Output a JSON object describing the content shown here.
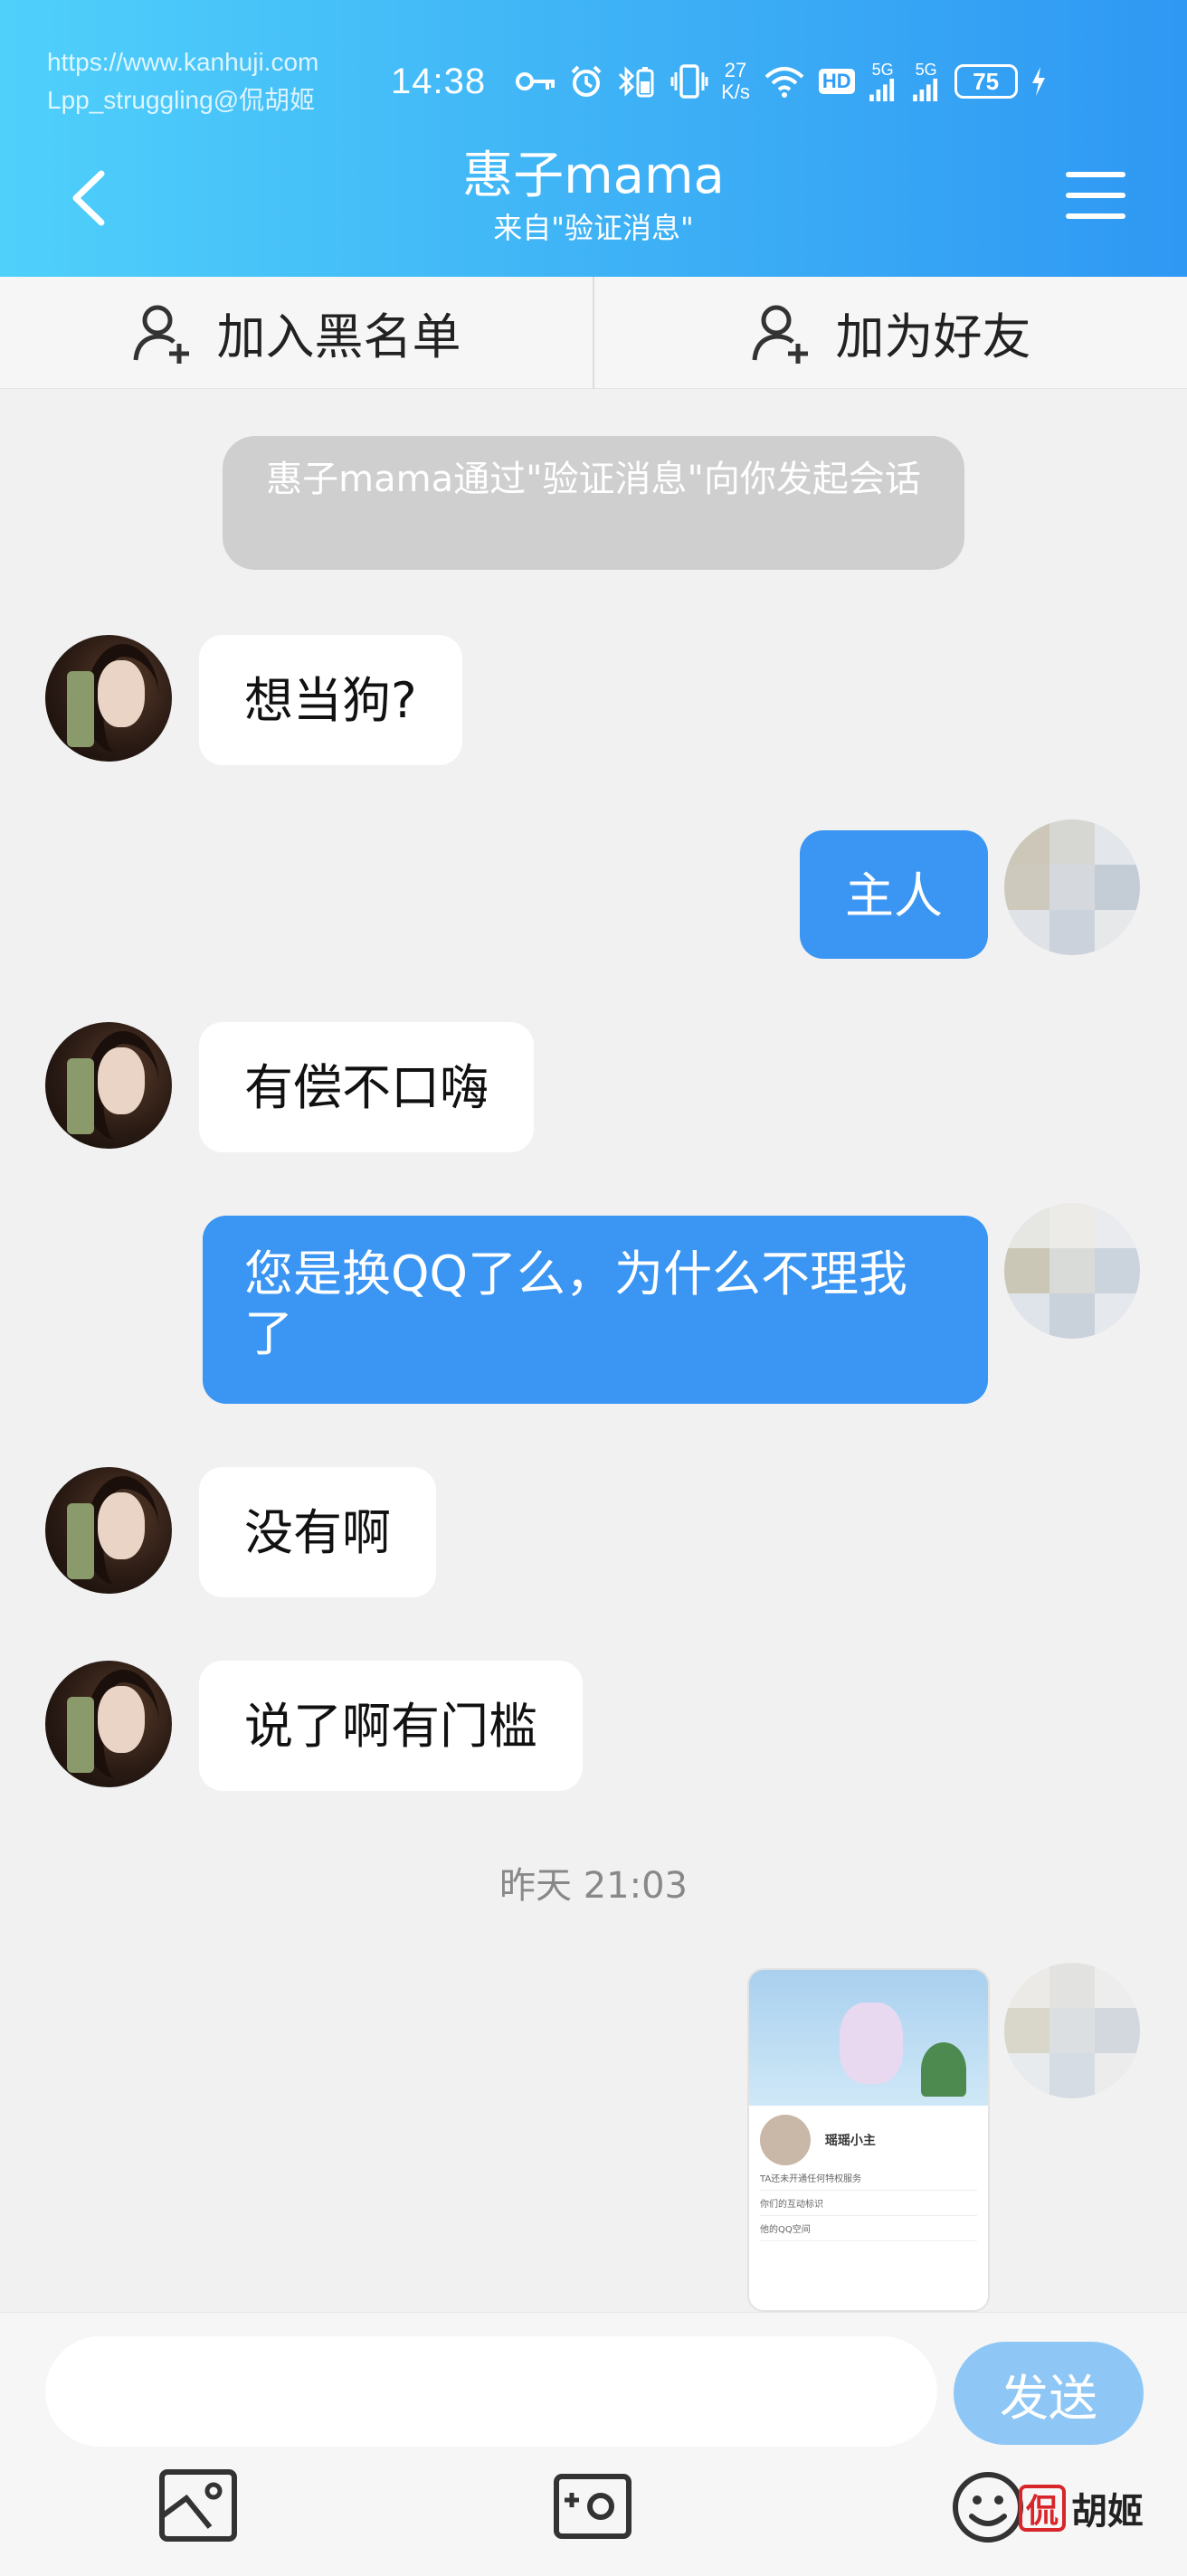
{
  "watermark": {
    "url": "https://www.kanhuji.com",
    "handle": "Lpp_struggling@侃胡姬"
  },
  "status_bar": {
    "time": "14:38",
    "net_speed_value": "27",
    "net_speed_unit": "K/s",
    "hd": "HD",
    "sim1_label": "5G",
    "sim2_label": "5G",
    "battery": "75"
  },
  "header": {
    "title": "惠子mama",
    "subtitle": "来自\"验证消息\""
  },
  "actions": {
    "blacklist_label": "加入黑名单",
    "add_friend_label": "加为好友"
  },
  "system_notice": "惠子mama通过\"验证消息\"向你发起会话",
  "messages": [
    {
      "side": "in",
      "text": "想当狗?"
    },
    {
      "side": "out",
      "text": "主人"
    },
    {
      "side": "in",
      "text": "有偿不口嗨"
    },
    {
      "side": "out",
      "text": "您是换QQ了么，为什么不理我了"
    },
    {
      "side": "in",
      "text": "没有啊"
    },
    {
      "side": "in",
      "text": "说了啊有门槛"
    }
  ],
  "time_divider": "昨天 21:03",
  "shared_screenshot": {
    "name": "瑶瑶小主",
    "row1": "TA还未开通任何特权服务",
    "row2": "你们的互动标识",
    "row3": "他的QQ空间"
  },
  "input": {
    "placeholder": "",
    "value": "",
    "send_label": "发送"
  },
  "brand": {
    "seal": "侃",
    "text": "胡姬"
  },
  "colors": {
    "header_gradient_start": "#4fd0fb",
    "header_gradient_end": "#2f98f3",
    "outgoing_bubble": "#3a95f3",
    "send_button": "#8ec7f6"
  }
}
